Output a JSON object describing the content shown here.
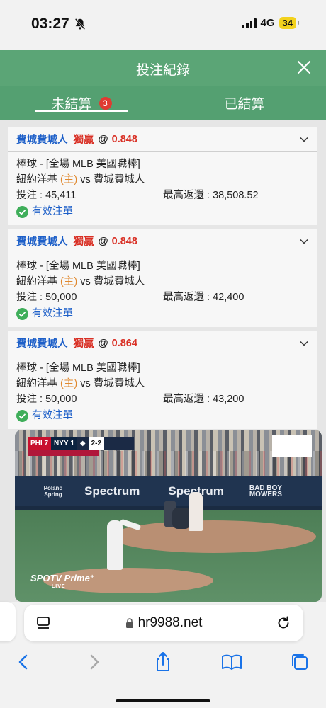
{
  "status": {
    "time": "03:27",
    "network": "4G",
    "battery": "34",
    "icons": [
      "bell-slash-icon",
      "signal-bars-icon",
      "battery-icon"
    ]
  },
  "header": {
    "title": "投注紀錄",
    "close_icon": "close-icon"
  },
  "tabs": [
    {
      "label": "未結算",
      "badge": "3",
      "active": true
    },
    {
      "label": "已結算",
      "active": false
    }
  ],
  "bets": [
    {
      "team": "費城費城人",
      "bet_type": "獨贏",
      "at": "@",
      "odds": "0.848",
      "sport": "棒球 - [全場 MLB 美國職棒]",
      "home_team": "紐約洋基",
      "home_marker": "(主)",
      "vs": "vs",
      "away_team": "費城費城人",
      "stake": "投注 : 45,411",
      "max_return": "最高返還 : 38,508.52",
      "status": "有效注單"
    },
    {
      "team": "費城費城人",
      "bet_type": "獨贏",
      "at": "@",
      "odds": "0.848",
      "sport": "棒球 - [全場 MLB 美國職棒]",
      "home_team": "紐約洋基",
      "home_marker": "(主)",
      "vs": "vs",
      "away_team": "費城費城人",
      "stake": "投注 : 50,000",
      "max_return": "最高返還 : 42,400",
      "status": "有效注單"
    },
    {
      "team": "費城費城人",
      "bet_type": "獨贏",
      "at": "@",
      "odds": "0.864",
      "sport": "棒球 - [全場 MLB 美國職棒]",
      "home_team": "紐約洋基",
      "home_marker": "(主)",
      "vs": "vs",
      "away_team": "費城費城人",
      "stake": "投注 : 50,000",
      "max_return": "最高返還 : 43,200",
      "status": "有效注單"
    }
  ],
  "video": {
    "scorebug": {
      "away": "PHI",
      "away_score": "7",
      "home": "NYY",
      "home_score": "1",
      "count": "2-2"
    },
    "ads": {
      "left": "Spectrum",
      "mid": "Spectrum",
      "right_top": "BAD BOY",
      "right_bottom": "MOWERS",
      "poland": "Poland Spring"
    },
    "broadcaster": "SPOTV Prime⁺",
    "broadcaster_sub": "LIVE"
  },
  "browser": {
    "url": "hr9988.net",
    "toolbar_icons": [
      "back-icon",
      "forward-icon",
      "share-icon",
      "bookmarks-icon",
      "tabs-icon"
    ]
  },
  "colors": {
    "header_green": "#5ba576",
    "tabs_green": "#54a071",
    "team_blue": "#1d5fc8",
    "odds_red": "#d93025",
    "host_orange": "#e0882e",
    "badge_red": "#e03a32",
    "check_green": "#3fae5a"
  }
}
